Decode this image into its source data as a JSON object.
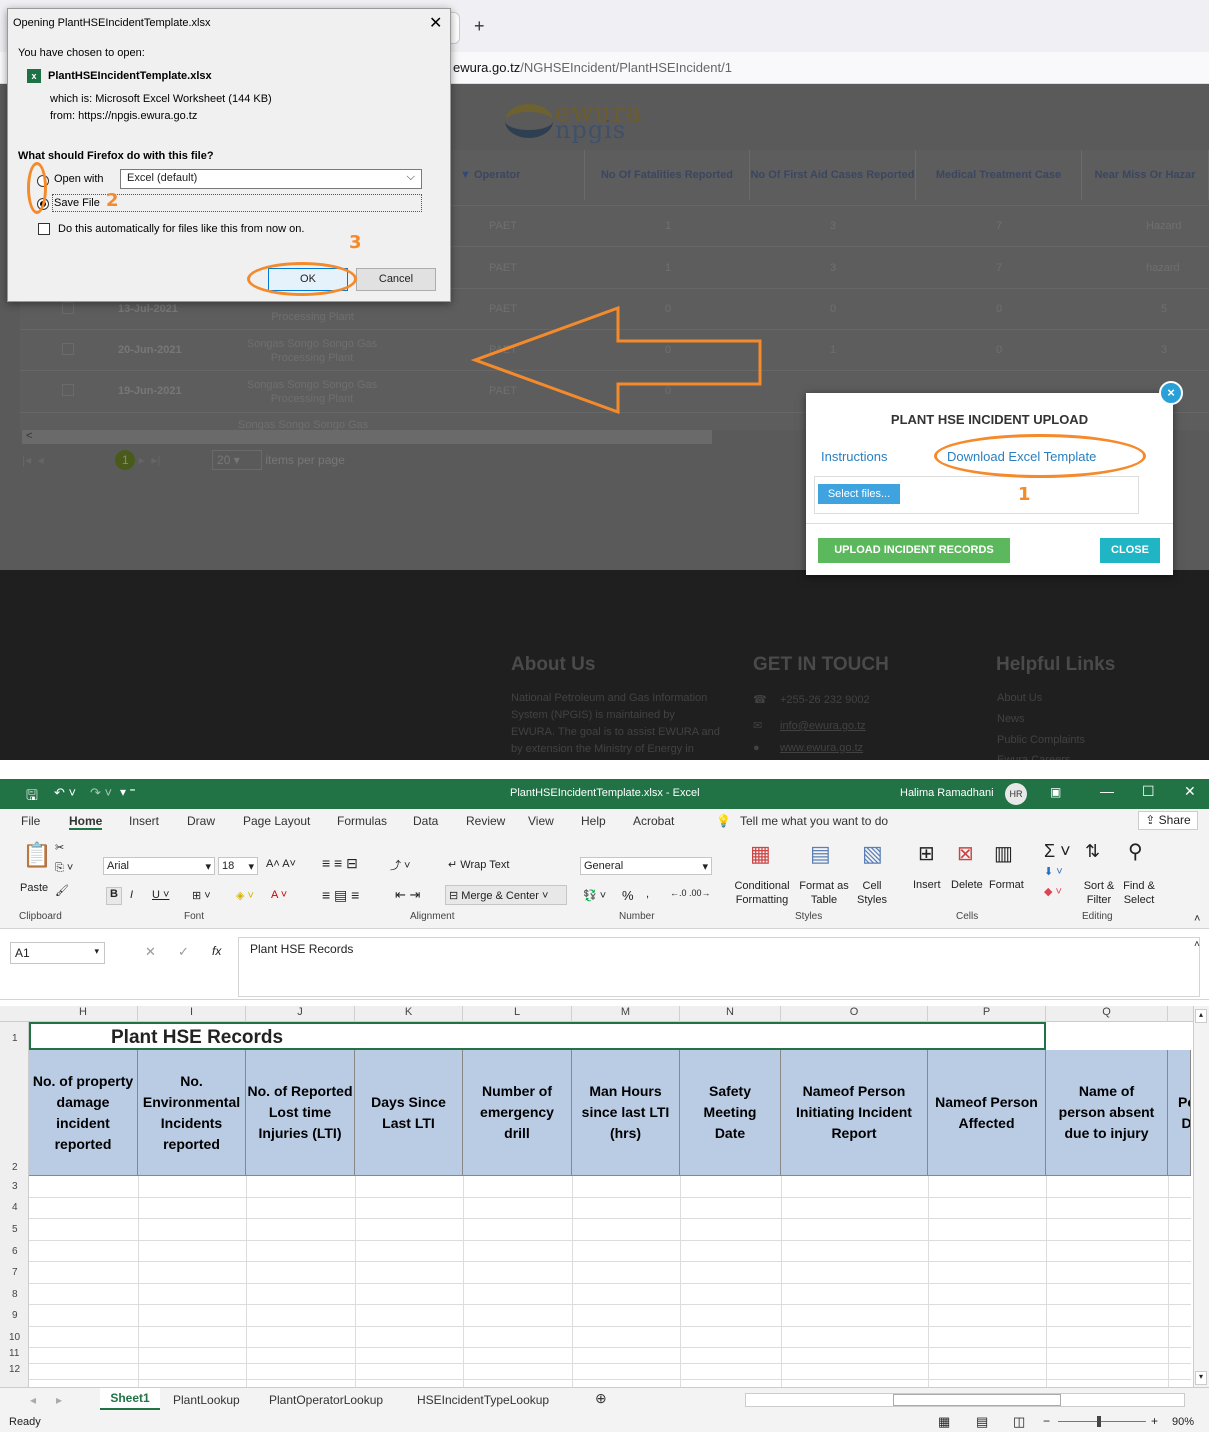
{
  "browser": {
    "new_tab": "+",
    "url_prefix": "ewura.go.tz",
    "url_path": "/NGHSEIncident/PlantHSEIncident/1",
    "logo_top": "ewura",
    "logo_bottom": "npgis"
  },
  "grid": {
    "columns": [
      "Operator",
      "No Of Fatalities Reported",
      "No Of First Aid Cases Reported",
      "Medical Treatment Case",
      "Near Miss Or Hazar"
    ],
    "rows": [
      {
        "date": "",
        "plant": "",
        "operator": "PAET",
        "fatal": "1",
        "firstaid": "3",
        "medical": "7",
        "nearmiss": "Hazard"
      },
      {
        "date": "",
        "plant": "",
        "operator": "PAET",
        "fatal": "1",
        "firstaid": "3",
        "medical": "7",
        "nearmiss": "hazard"
      },
      {
        "date": "13-Jul-2021",
        "plant": "Processing Plant",
        "operator": "PAET",
        "fatal": "0",
        "firstaid": "0",
        "medical": "0",
        "nearmiss": "5"
      },
      {
        "date": "20-Jun-2021",
        "plant": "Songas Songo Songo Gas Processing Plant",
        "operator": "PAET",
        "fatal": "0",
        "firstaid": "1",
        "medical": "0",
        "nearmiss": "3"
      },
      {
        "date": "19-Jun-2021",
        "plant": "Songas Songo Songo Gas Processing Plant",
        "operator": "PAET",
        "fatal": "0",
        "firstaid": "",
        "medical": "",
        "nearmiss": ""
      }
    ],
    "partial_row": "Songas Songo Songo Gas",
    "pager_page": "1",
    "pager_size": "20",
    "pager_label": "items per page"
  },
  "footer": {
    "about_title": "About Us",
    "about_text": "National Petroleum and Gas Information System (NPGIS) is maintained by EWURA. The goal is to assist EWURA and by extension the Ministry of Energy in",
    "contact_title": "GET IN TOUCH",
    "phone": "+255-26 232 9002",
    "email": "info@ewura.go.tz",
    "web": "www.ewura.go.tz",
    "links_title": "Helpful Links",
    "links": [
      "About Us",
      "News",
      "Public Complaints",
      "Ewura Careers"
    ]
  },
  "ff_dialog": {
    "title": "Opening PlantHSEIncidentTemplate.xlsx",
    "chosen": "You have chosen to open:",
    "filename": "PlantHSEIncidentTemplate.xlsx",
    "which_is": "which is:  Microsoft Excel Worksheet (144 KB)",
    "from": "from:  https://npgis.ewura.go.tz",
    "question": "What should Firefox do with this file?",
    "open_with": "Open with",
    "open_app": "Excel (default)",
    "save_file": "Save File",
    "auto": "Do this automatically for files like this from now on.",
    "ok": "OK",
    "cancel": "Cancel"
  },
  "upload_modal": {
    "title": "PLANT HSE INCIDENT UPLOAD",
    "instructions": "Instructions",
    "download": "Download Excel Template",
    "select": "Select files...",
    "upload": "UPLOAD INCIDENT RECORDS",
    "close": "CLOSE"
  },
  "annotations": {
    "n1": "1",
    "n2": "2",
    "n3": "3"
  },
  "excel": {
    "title": "PlantHSEIncidentTemplate.xlsx  -  Excel",
    "user": "Halima Ramadhani",
    "user_initials": "HR",
    "tabs": [
      "File",
      "Home",
      "Insert",
      "Draw",
      "Page Layout",
      "Formulas",
      "Data",
      "Review",
      "View",
      "Help",
      "Acrobat"
    ],
    "tell_me": "Tell me what you want to do",
    "share": "Share",
    "font_name": "Arial",
    "font_size": "18",
    "number_format": "General",
    "wrap_text": "Wrap Text",
    "merge_center": "Merge & Center",
    "paste": "Paste",
    "cond_format": "Conditional Formatting",
    "format_table": "Format as Table",
    "cell_styles": "Cell Styles",
    "insert": "Insert",
    "delete": "Delete",
    "format": "Format",
    "sort_filter": "Sort & Filter",
    "find_select": "Find & Select",
    "groups": [
      "Clipboard",
      "Font",
      "Alignment",
      "Number",
      "Styles",
      "Cells",
      "Editing"
    ],
    "name_box": "A1",
    "formula": "Plant HSE Records",
    "col_letters": [
      "H",
      "I",
      "J",
      "K",
      "L",
      "M",
      "N",
      "O",
      "P",
      "Q"
    ],
    "sheet_title": "Plant HSE Records",
    "headers": [
      "No. of property damage incident reported",
      "No. Environmental Incidents reported",
      "No. of Reported Lost time Injuries (LTI)",
      "Days Since Last LTI",
      "Number of emergency drill",
      "Man Hours since last LTI (hrs)",
      "Safety Meeting Date",
      "Nameof Person Initiating Incident Report",
      "Nameof Person Affected",
      "Name of person absent due to injury",
      "Pe D"
    ],
    "rows": [
      "1",
      "2",
      "3",
      "4",
      "5",
      "6",
      "7",
      "8",
      "9",
      "10",
      "11",
      "12"
    ],
    "sheets": [
      "Sheet1",
      "PlantLookup",
      "PlantOperatorLookup",
      "HSEIncidentTypeLookup"
    ],
    "status": "Ready",
    "zoom": "90%"
  }
}
